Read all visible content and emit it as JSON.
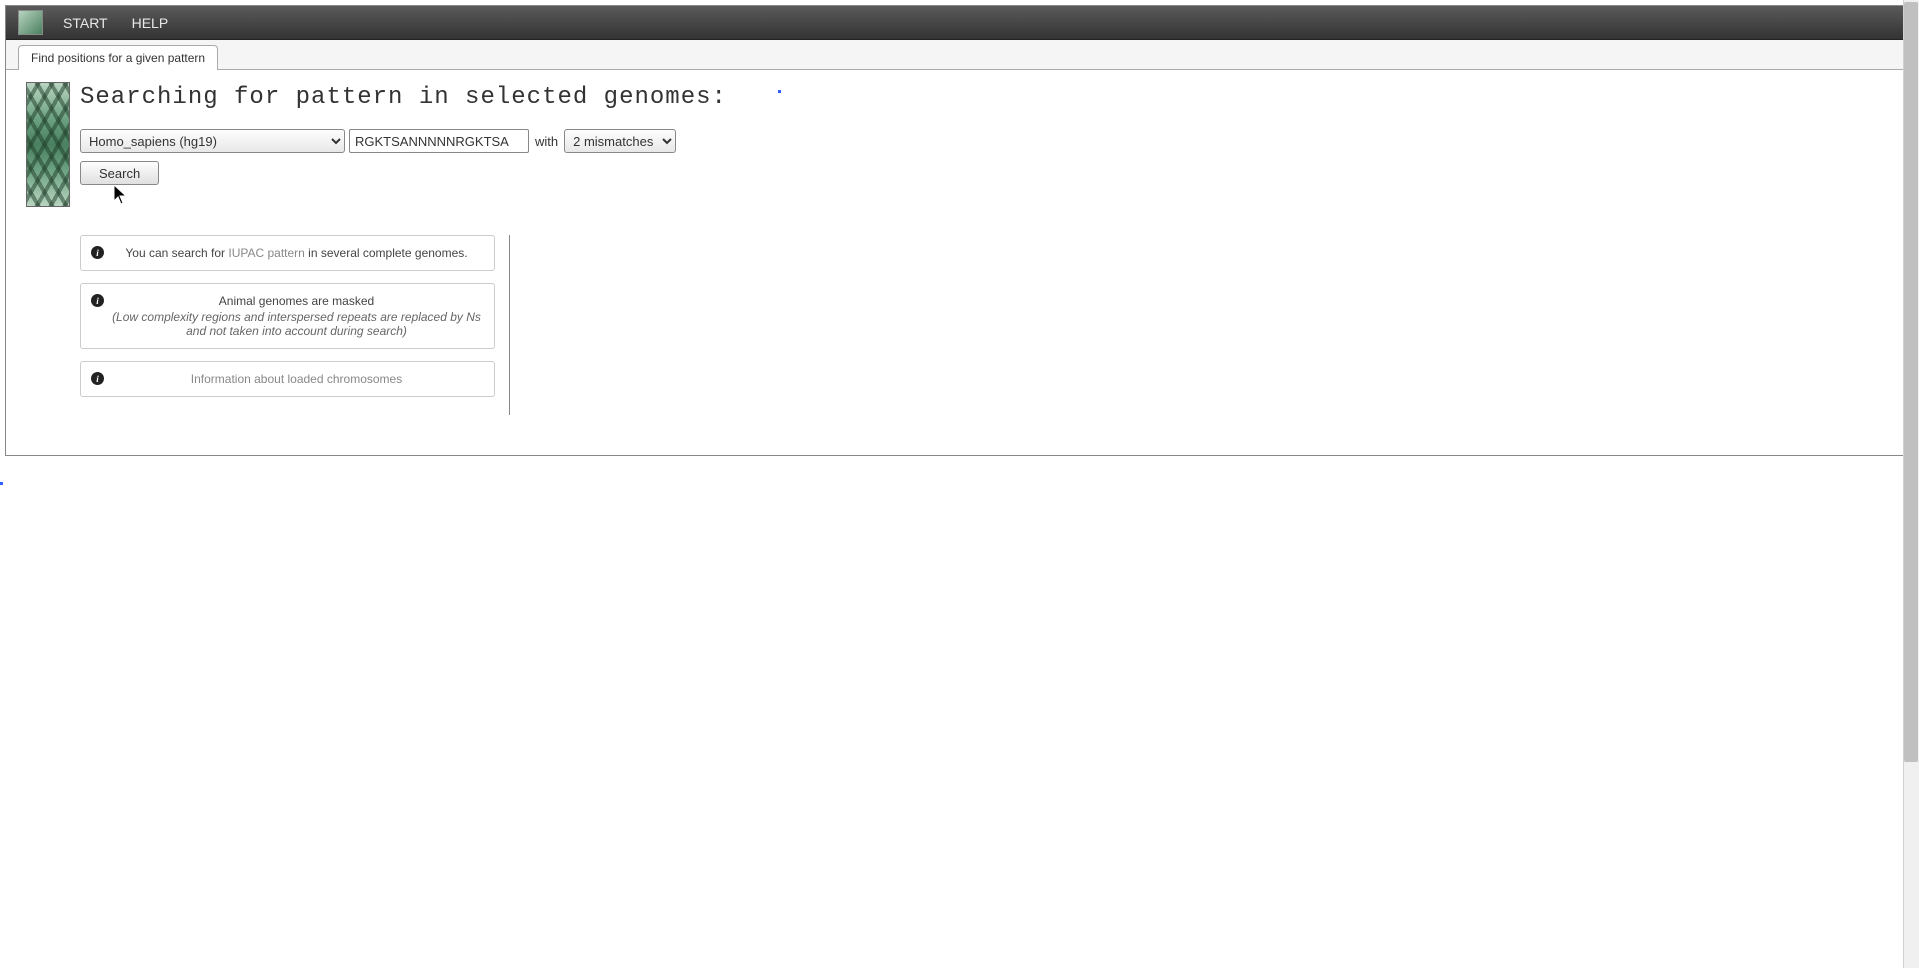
{
  "topbar": {
    "items": [
      "START",
      "HELP"
    ]
  },
  "tab": {
    "label": "Find positions for a given pattern"
  },
  "heading": "Searching for pattern in selected genomes:",
  "form": {
    "genome_selected": "Homo_sapiens (hg19)",
    "pattern_value": "RGKTSANNNNNRGKTSA",
    "with_label": "with",
    "mismatch_selected": "2 mismatches",
    "search_label": "Search"
  },
  "info": {
    "box1": {
      "pre": "You can search for ",
      "link": "IUPAC pattern",
      "post": " in several complete genomes."
    },
    "box2": {
      "title": "Animal genomes are masked",
      "sub": "(Low complexity regions and interspersed repeats are replaced by Ns and not taken into account during search)"
    },
    "box3": {
      "link": "Information about loaded chromosomes"
    }
  }
}
